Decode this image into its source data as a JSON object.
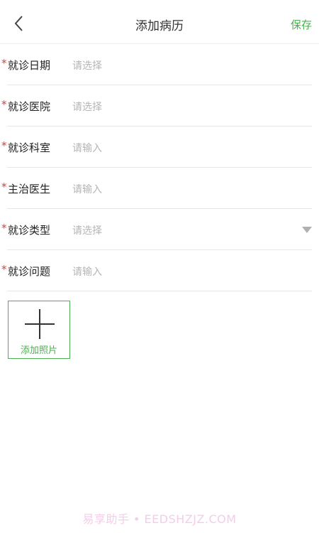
{
  "header": {
    "title": "添加病历",
    "save_label": "保存"
  },
  "form": {
    "rows": [
      {
        "label": "就诊日期",
        "value": "请选择",
        "required": true
      },
      {
        "label": "就诊医院",
        "value": "请选择",
        "required": true
      },
      {
        "label": "就诊科室",
        "value": "请输入",
        "required": true
      },
      {
        "label": "主治医生",
        "value": "请输入",
        "required": true
      },
      {
        "label": "就诊类型",
        "value": "请选择",
        "required": true,
        "has_dropdown": true
      },
      {
        "label": "就诊问题",
        "value": "请输入",
        "required": true
      }
    ],
    "required_mark": "*"
  },
  "add_photo": {
    "label": "添加照片",
    "icon": "plus-icon"
  },
  "watermark": "易享助手 • EEDSHZJZ.COM",
  "colors": {
    "accent": "#4caf50",
    "required": "#e53935",
    "placeholder": "#b5b5b5"
  }
}
